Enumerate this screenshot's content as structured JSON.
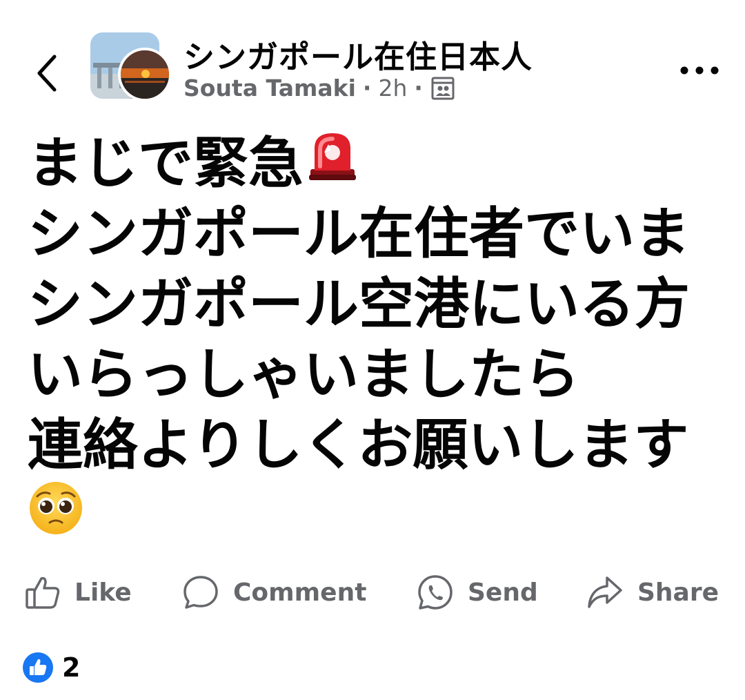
{
  "header": {
    "group_name": "シンガポール在住日本人",
    "author": "Souta Tamaki",
    "separator": "·",
    "time": "2h",
    "audience_icon": "members-only-icon"
  },
  "post": {
    "lines": [
      "まじで緊急",
      "シンガポール在住者でいま",
      "シンガポール空港にいる方",
      "いらっしゃいましたら",
      "連絡よりしくお願いします"
    ],
    "emojis": [
      "rotating-light-emoji",
      "pleading-face-emoji"
    ]
  },
  "actions": {
    "like_label": "Like",
    "comment_label": "Comment",
    "send_label": "Send",
    "share_label": "Share"
  },
  "reactions": {
    "count": "2",
    "icon": "like-reaction-icon"
  },
  "colors": {
    "text": "#050505",
    "secondary_text": "#65676b",
    "like_blue": "#1877f2",
    "siren_red": "#e0202a"
  }
}
